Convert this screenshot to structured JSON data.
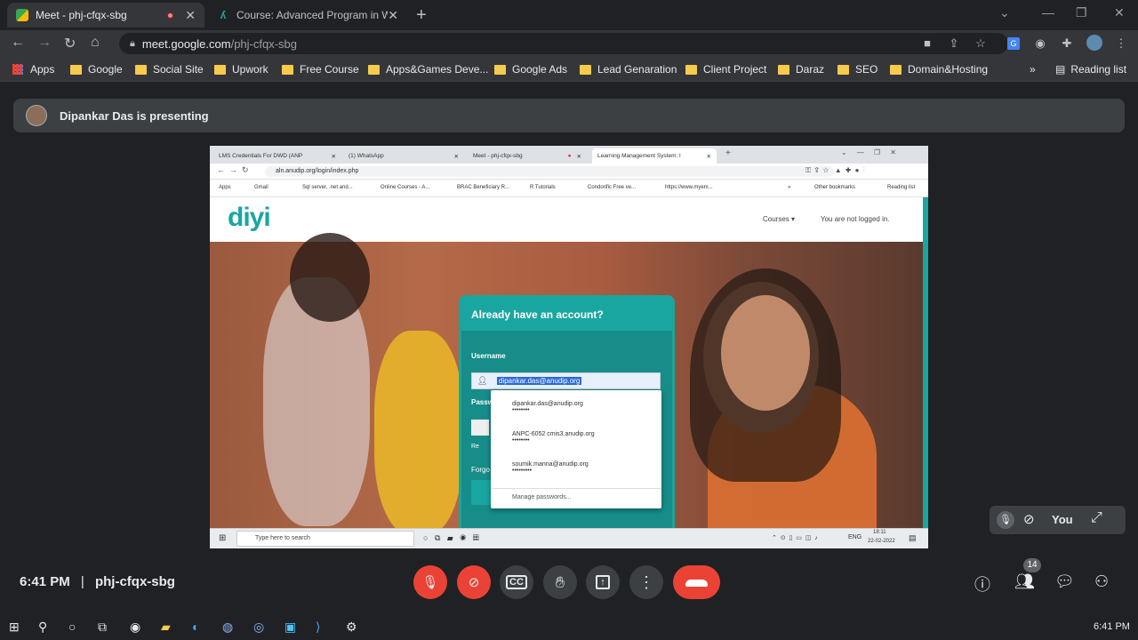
{
  "browser": {
    "tabs": [
      {
        "title": "Meet - phj-cfqx-sbg",
        "active": true
      },
      {
        "title": "Course: Advanced Program in W",
        "active": false
      }
    ],
    "url_host": "meet.google.com",
    "url_path": "/phj-cfqx-sbg",
    "bookmarks": [
      "Apps",
      "Google",
      "Social Site",
      "Upwork",
      "Free Course",
      "Apps&Games Deve...",
      "Google Ads",
      "Lead Genaration",
      "Client Project",
      "Daraz",
      "SEO",
      "Domain&Hosting"
    ],
    "reading_list": "Reading list",
    "more_bookmarks": "»"
  },
  "meet": {
    "presenting_text": "Dipankar Das is presenting",
    "time": "6:41 PM",
    "separator": "|",
    "meeting_code": "phj-cfqx-sbg",
    "participants_count": "14",
    "self_label": "You"
  },
  "shared": {
    "tabs": [
      "LMS Credentials For DWD (ANP",
      "(1) WhatsApp",
      "Meet - phj-cfqx-sbg",
      "Learning Management System: l"
    ],
    "url": "aln.anudip.org/login/index.php",
    "bookmarks": [
      "Apps",
      "Gmail",
      "Sql server, .net and...",
      "Online Courses - A...",
      "BRAC Beneficiary R...",
      "R Tutorials",
      "Condorific Free ve...",
      "https://www.myem...",
      "»",
      "Other bookmarks",
      "Reading list"
    ],
    "logo": "diyi",
    "nav_courses": "Courses ▾",
    "not_logged_in": "You are not logged in.",
    "login_heading": "Already have an account?",
    "username_label": "Username",
    "username_value": "dipankar.das@anudip.org",
    "password_label_partial": "Passw",
    "remember_partial": "Re",
    "forgot_partial": "Forgo",
    "autocomplete": [
      {
        "user": "dipankar.das@anudip.org",
        "dots": "••••••••"
      },
      {
        "user": "ANPC-6052 cmis3.anudip.org",
        "dots": "••••••••"
      },
      {
        "user": "soumik.manna@anudip.org",
        "dots": "•••••••••"
      }
    ],
    "manage_passwords": "Manage passwords...",
    "search_placeholder": "Type here to search",
    "tray_lang": "ENG",
    "tray_time": "18:11",
    "tray_date": "22-02-2022"
  },
  "windows": {
    "clock": "6:41 PM"
  },
  "colors": {
    "meet_red": "#ea4335",
    "lms_teal": "#1aa6a0"
  }
}
